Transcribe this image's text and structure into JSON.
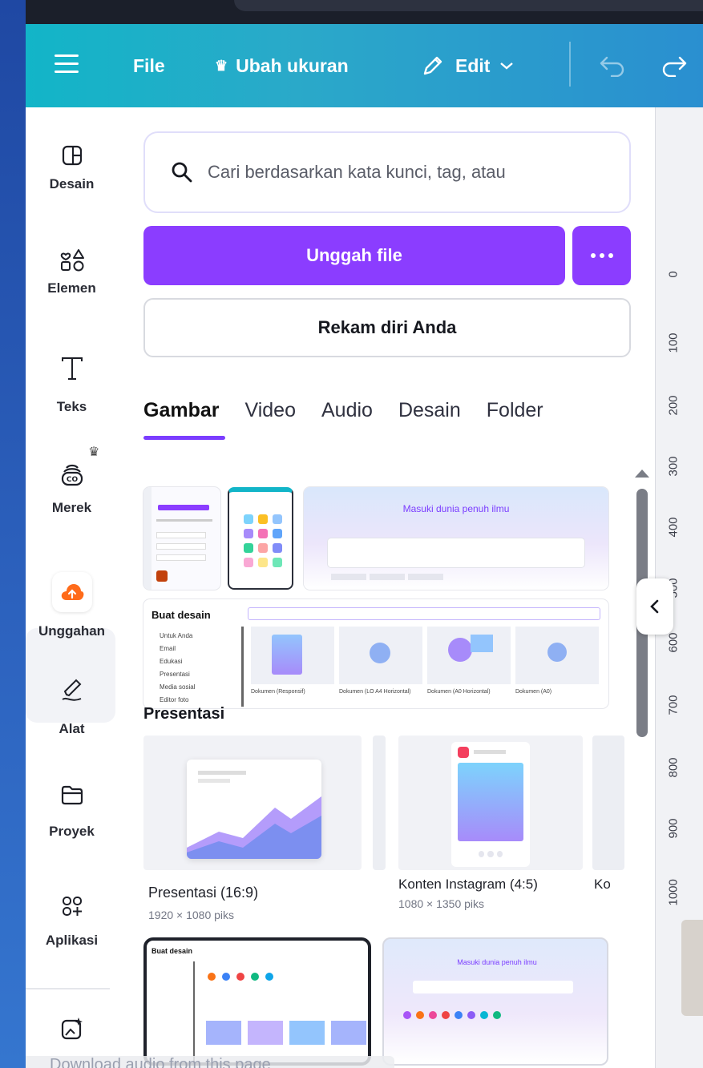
{
  "header": {
    "file_label": "File",
    "resize_label": "Ubah ukuran",
    "edit_label": "Edit"
  },
  "sidebar": {
    "items": [
      {
        "label": "Desain",
        "icon": "layout-icon"
      },
      {
        "label": "Elemen",
        "icon": "shapes-icon"
      },
      {
        "label": "Teks",
        "icon": "text-icon"
      },
      {
        "label": "Merek",
        "icon": "brand-icon"
      },
      {
        "label": "Unggahan",
        "icon": "upload-cloud-icon"
      },
      {
        "label": "Alat",
        "icon": "pen-tool-icon"
      },
      {
        "label": "Proyek",
        "icon": "folder-icon"
      },
      {
        "label": "Aplikasi",
        "icon": "apps-icon"
      }
    ]
  },
  "panel": {
    "search_placeholder": "Cari berdasarkan kata kunci, tag, atau",
    "upload_button": "Unggah file",
    "record_button": "Rekam diri Anda",
    "tabs": [
      "Gambar",
      "Video",
      "Audio",
      "Desain",
      "Folder"
    ],
    "active_tab": "Gambar",
    "thumb_texts": {
      "masuki": "Masuki dunia penuh ilmu",
      "buat_desain": "Buat desain",
      "doc_labels": [
        "Dokumen (Responsif)",
        "Dokumen (LO A4 Horizontal)",
        "Dokumen (A0 Horizontal)",
        "Dokumen (A0)"
      ],
      "left_menu": [
        "Untuk Anda",
        "Email",
        "Edukasi",
        "Presentasi",
        "Media sosial",
        "Editor foto"
      ]
    },
    "section_title": "Presentasi",
    "cards": [
      {
        "label": "Presentasi (16:9)",
        "sub": "1920 × 1080 piks"
      },
      {
        "label": "Konten Instagram (4:5)",
        "sub": "1080 × 1350 piks"
      },
      {
        "label": "Ko"
      }
    ]
  },
  "ruler": {
    "ticks": [
      "0",
      "100",
      "200",
      "300",
      "400",
      "500",
      "600",
      "700",
      "800",
      "900",
      "1000"
    ]
  },
  "download_bar": "Download audio from this page",
  "colors": {
    "accent": "#8b3dff",
    "header_gradient_start": "#12b5c8",
    "header_gradient_end": "#2a8fd0",
    "active_upload": "#ff6b1a"
  }
}
